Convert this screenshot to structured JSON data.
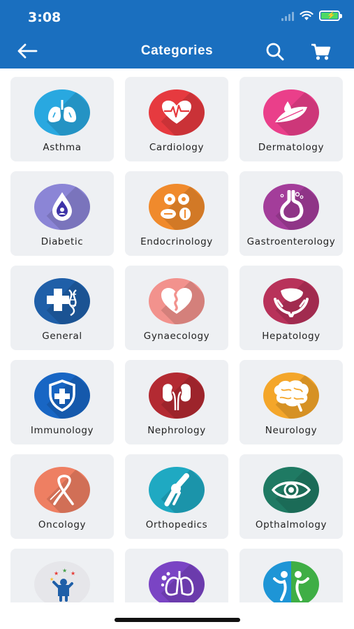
{
  "status_bar": {
    "time": "3:08"
  },
  "header": {
    "title": "Categories"
  },
  "colors": {
    "header_bg": "#1a6fbf",
    "tile_bg": "#eef0f3"
  },
  "categories": [
    {
      "label": "Asthma",
      "icon": "lungs-icon",
      "color": "#29a8e0"
    },
    {
      "label": "Cardiology",
      "icon": "heart-pulse-icon",
      "color": "#e63a3f"
    },
    {
      "label": "Dermatology",
      "icon": "feather-drop-icon",
      "color": "#ea3f8a"
    },
    {
      "label": "Diabetic",
      "icon": "blood-drop-icon",
      "color": "#8b85d6"
    },
    {
      "label": "Endocrinology",
      "icon": "glands-icon",
      "color": "#f08a2c"
    },
    {
      "label": "Gastroenterology",
      "icon": "stomach-icon",
      "color": "#a33d9a"
    },
    {
      "label": "General",
      "icon": "cross-dna-icon",
      "color": "#1f5fa8"
    },
    {
      "label": "Gynaecology",
      "icon": "uterus-heart-icon",
      "color": "#f2928d"
    },
    {
      "label": "Hepatology",
      "icon": "liver-hands-icon",
      "color": "#b8325a"
    },
    {
      "label": "Immunology",
      "icon": "shield-cross-icon",
      "color": "#1866c4"
    },
    {
      "label": "Nephrology",
      "icon": "kidneys-icon",
      "color": "#b32a32"
    },
    {
      "label": "Neurology",
      "icon": "brain-icon",
      "color": "#f4a62a"
    },
    {
      "label": "Oncology",
      "icon": "ribbon-icon",
      "color": "#ee7f62"
    },
    {
      "label": "Orthopedics",
      "icon": "knee-joint-icon",
      "color": "#1fa9c2"
    },
    {
      "label": "Opthalmology",
      "icon": "eye-icon",
      "color": "#1f7a63"
    },
    {
      "label": "",
      "icon": "child-stars-icon",
      "color": "#e6e6ea"
    },
    {
      "label": "",
      "icon": "lungs-virus-icon",
      "color": "#7a44c4"
    },
    {
      "label": "",
      "icon": "people-icon",
      "color": "#1e95d6"
    }
  ]
}
